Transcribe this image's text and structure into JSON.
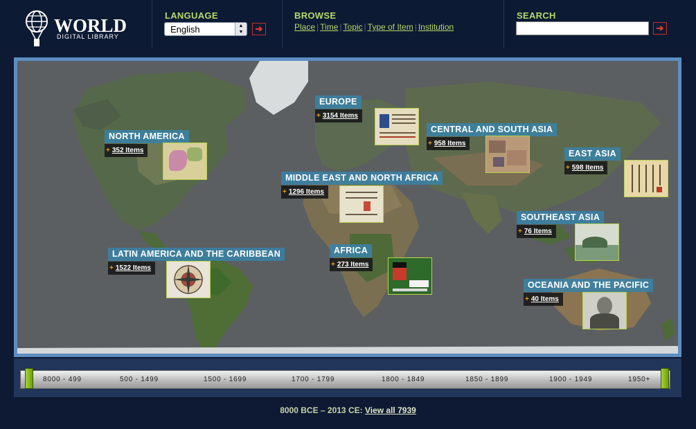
{
  "header": {
    "logo_word": "WORLD",
    "logo_sub": "DIGITAL LIBRARY",
    "language_label": "LANGUAGE",
    "language_value": "English",
    "browse_label": "BROWSE",
    "browse_links": [
      "Place",
      "Time",
      "Topic",
      "Type of Item",
      "Institution"
    ],
    "search_label": "SEARCH",
    "search_value": ""
  },
  "regions": [
    {
      "name": "EUROPE",
      "count": "3154 Items",
      "thumb": "manuscript-thumbnail"
    },
    {
      "name": "NORTH AMERICA",
      "count": "352 Items",
      "thumb": "map-thumbnail"
    },
    {
      "name": "CENTRAL AND SOUTH ASIA",
      "count": "958 Items",
      "thumb": "painting-thumbnail"
    },
    {
      "name": "EAST ASIA",
      "count": "598 Items",
      "thumb": "scroll-thumbnail"
    },
    {
      "name": "MIDDLE EAST AND NORTH AFRICA",
      "count": "1296 Items",
      "thumb": "document-thumbnail"
    },
    {
      "name": "SOUTHEAST ASIA",
      "count": "76 Items",
      "thumb": "landscape-thumbnail"
    },
    {
      "name": "LATIN AMERICA AND THE CARIBBEAN",
      "count": "1522 Items",
      "thumb": "compass-rose-thumbnail"
    },
    {
      "name": "AFRICA",
      "count": "273 Items",
      "thumb": "malawi-poster-thumbnail"
    },
    {
      "name": "OCEANIA AND THE PACIFIC",
      "count": "40 Items",
      "thumb": "portrait-thumbnail"
    }
  ],
  "timeline": {
    "periods": [
      "8000 - 499",
      "500 - 1499",
      "1500 - 1699",
      "1700 - 1799",
      "1800 - 1849",
      "1850 - 1899",
      "1900 - 1949",
      "1950+"
    ]
  },
  "footer": {
    "range_text": "8000 BCE – 2013 CE:",
    "view_all": "View all 7939"
  },
  "colors": {
    "background": "#0e1a33",
    "accent_green": "#b6d86a",
    "label_blue": "#3a82a5",
    "button_red": "#e03a2e"
  }
}
